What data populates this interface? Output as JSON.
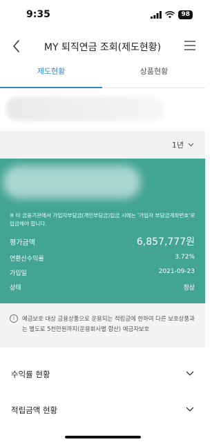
{
  "status_bar": {
    "time": "9:35",
    "battery": "98"
  },
  "nav": {
    "title": "MY 퇴직연금 조회(제도현황)"
  },
  "tabs": [
    {
      "label": "제도현황"
    },
    {
      "label": "상품현황"
    }
  ],
  "filter": {
    "period": "1년"
  },
  "card": {
    "notice": "※ 타 금융기관에서 가입자부담금(개인부담금)입금 시에는 '가입자 부담금계좌번호'로 입금해야 합니다.",
    "rows": [
      {
        "label": "평가금액",
        "value": "6,857,777원"
      },
      {
        "label": "연환산수익률",
        "value": "3.72%"
      },
      {
        "label": "가입일",
        "value": "2021-09-23"
      },
      {
        "label": "상태",
        "value": "정상"
      }
    ]
  },
  "protection": {
    "text": "예금보호 대상 금융상품으로 운용되는 적립금에 한하여 다른 보호상품과는 별도로 5천만원까지(운용회사별 합산) 예금자보호"
  },
  "sections": [
    {
      "title": "수익률 현황"
    },
    {
      "title": "적립금액 현황"
    }
  ],
  "colors": {
    "accent": "#2f8ac9",
    "card": "#43a493"
  }
}
